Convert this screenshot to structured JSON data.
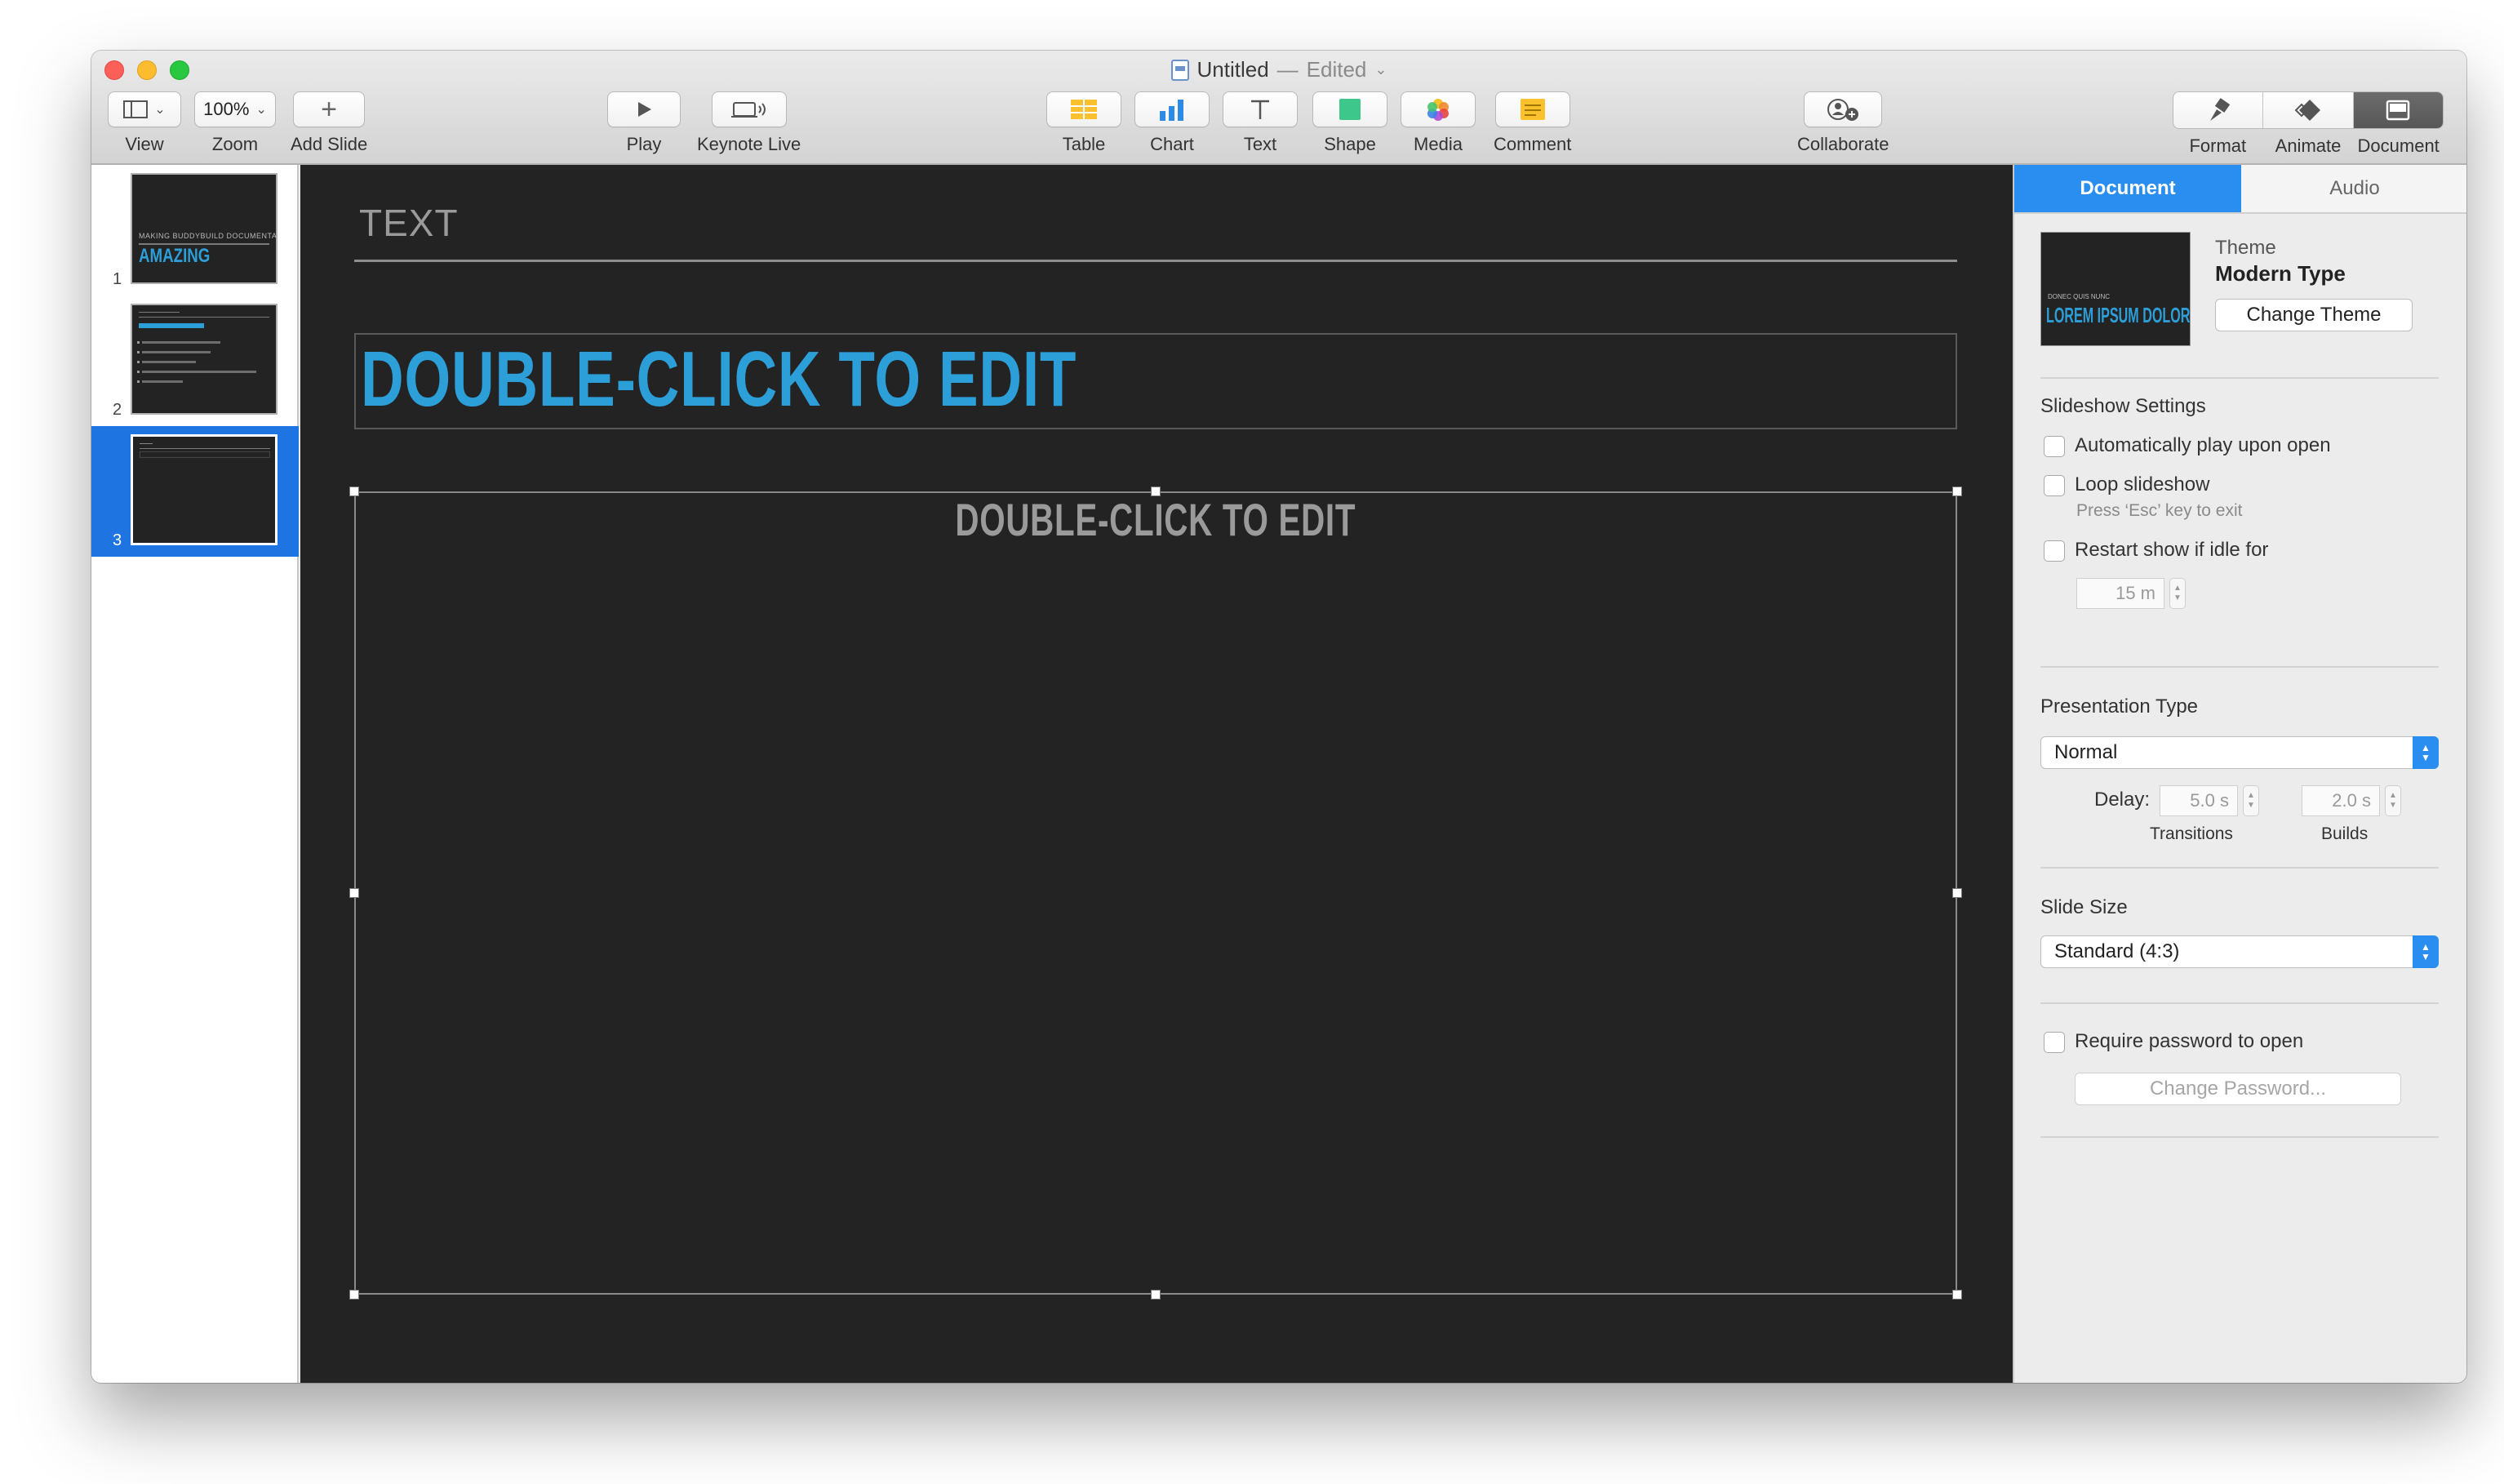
{
  "window": {
    "title": "Untitled",
    "separator": " — ",
    "edited": "Edited"
  },
  "toolbar": {
    "view_label": "View",
    "zoom_value": "100%",
    "zoom_label": "Zoom",
    "add_slide_label": "Add Slide",
    "play_label": "Play",
    "keynote_live_label": "Keynote Live",
    "table_label": "Table",
    "chart_label": "Chart",
    "text_label": "Text",
    "shape_label": "Shape",
    "media_label": "Media",
    "comment_label": "Comment",
    "collaborate_label": "Collaborate",
    "format_label": "Format",
    "animate_label": "Animate",
    "document_label": "Document"
  },
  "navigator": {
    "slides": [
      {
        "number": "1",
        "small": "MAKING BUDDYBUILD DOCUMENTATION",
        "big": "AMAZING"
      },
      {
        "number": "2"
      },
      {
        "number": "3"
      }
    ]
  },
  "slide": {
    "label": "TEXT",
    "title_placeholder": "DOUBLE-CLICK TO EDIT",
    "body_placeholder": "DOUBLE-CLICK TO EDIT"
  },
  "inspector": {
    "tabs": [
      "Document",
      "Audio"
    ],
    "theme_label": "Theme",
    "theme_name": "Modern Type",
    "theme_thumb_small": "DONEC QUIS NUNC",
    "theme_thumb_big": "LOREM IPSUM DOLOR",
    "change_theme": "Change Theme",
    "slideshow_settings": "Slideshow Settings",
    "auto_play": "Automatically play upon open",
    "loop": "Loop slideshow",
    "loop_hint": "Press ‘Esc’ key to exit",
    "restart": "Restart show if idle for",
    "idle_value": "15 m",
    "presentation_type": "Presentation Type",
    "presentation_value": "Normal",
    "delay_label": "Delay:",
    "transitions_value": "5.0 s",
    "builds_value": "2.0 s",
    "transitions_label": "Transitions",
    "builds_label": "Builds",
    "slide_size": "Slide Size",
    "slide_size_value": "Standard (4:3)",
    "require_password": "Require password to open",
    "change_password": "Change Password..."
  }
}
